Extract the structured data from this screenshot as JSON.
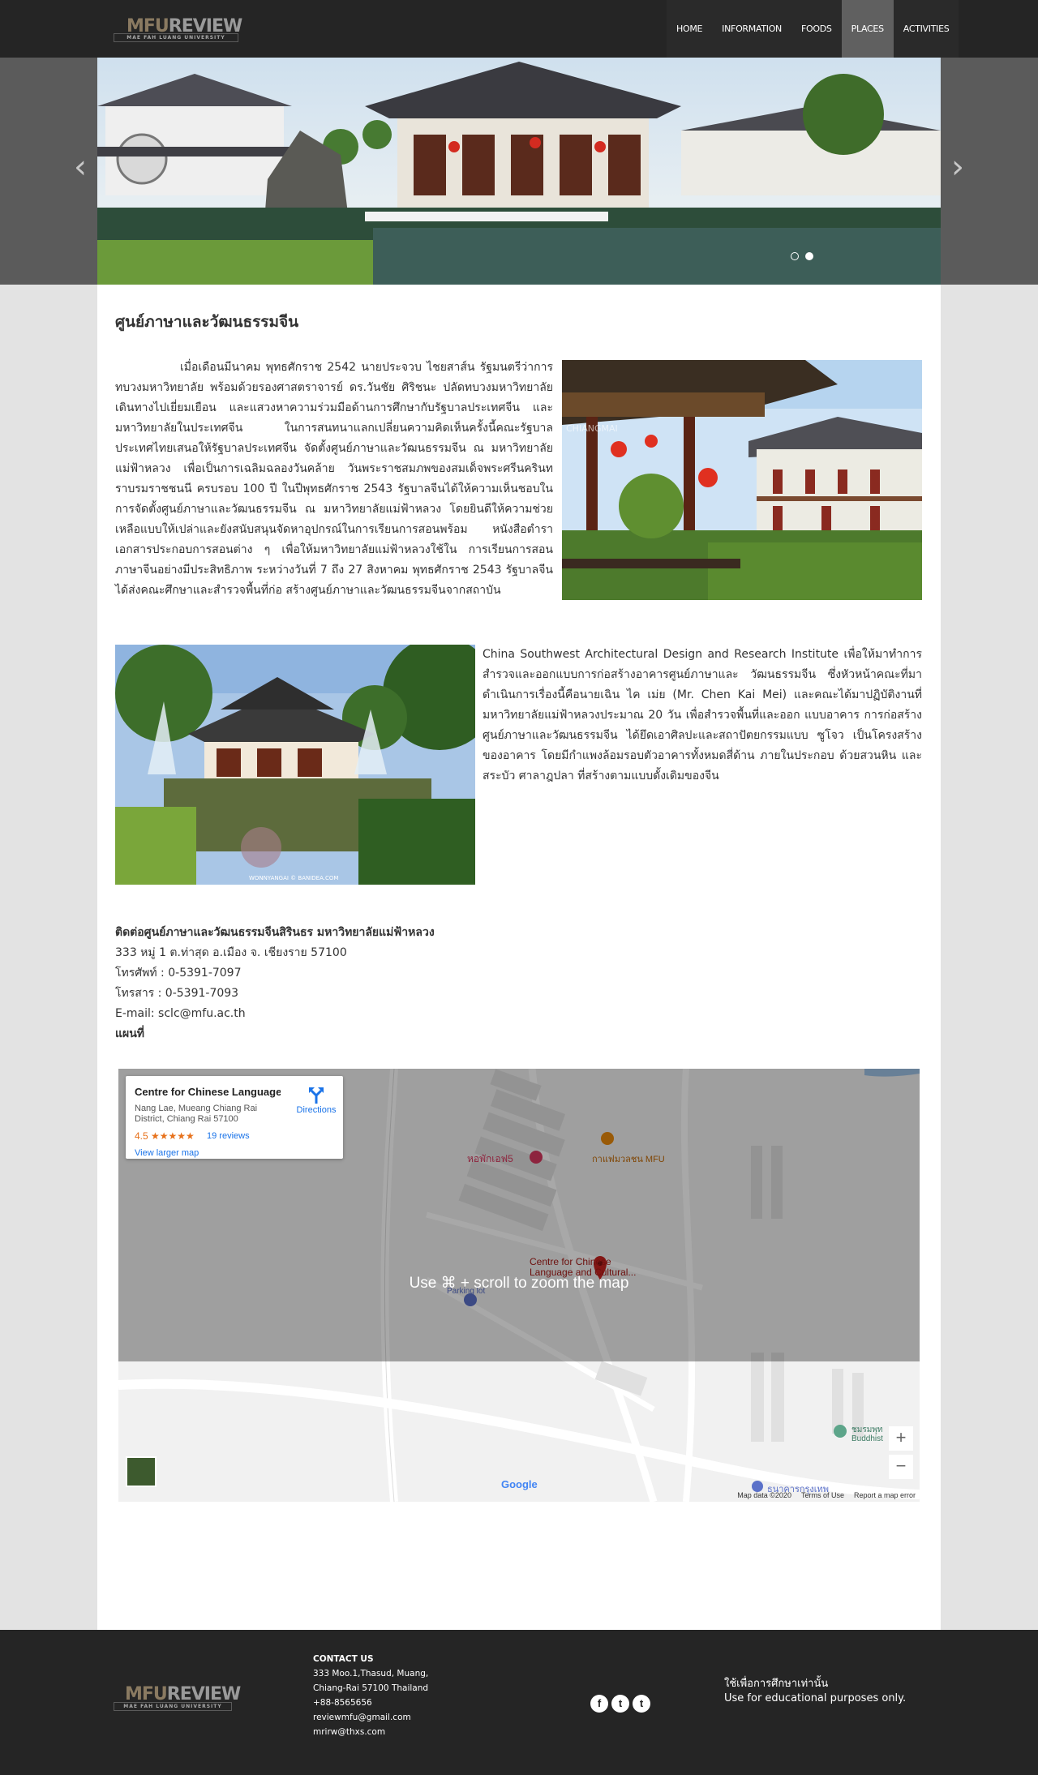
{
  "navbar": {
    "logo": {
      "main_a": "MFU",
      "main_b": "REVIEW",
      "sub": "MAE FAH LUANG UNIVERSITY"
    },
    "items": [
      {
        "label": "HOME"
      },
      {
        "label": "INFORMATION"
      },
      {
        "label": "FOODS"
      },
      {
        "label": "PLACES",
        "active": true
      },
      {
        "label": "ACTIVITIES"
      }
    ]
  },
  "carousel": {
    "prev_icon": "chevron-left-icon",
    "next_icon": "chevron-right-icon",
    "prev_glyph": "‹",
    "next_glyph": "›"
  },
  "content": {
    "title": "ศูนย์ภาษาและวัฒนธรรมจีน",
    "paragraph1": "เมื่อเดือนมีนาคม พุทธศักราช 2542 นายประจวบ ไชยสาส์น รัฐมนตรีว่าการทบวงมหาวิทยาลัย พร้อมด้วยรองศาสตราจารย์ ดร.วันชัย ศิริชนะ ปลัดทบวงมหาวิทยาลัยเดินทางไปเยี่ยมเยือน และแสวงหาความร่วมมือด้านการศึกษากับรัฐบาลประเทศจีน และมหาวิทยาลัยในประเทศจีน ในการสนทนาแลกเปลี่ยนความคิดเห็นครั้งนี้คณะรัฐบาลประเทศไทยเสนอให้รัฐบาลประเทศจีน จัดตั้งศูนย์ภาษาและวัฒนธรรมจีน ณ มหาวิทยาลัยแม่ฟ้าหลวง เพื่อเป็นการเฉลิมฉลองวันคล้าย วันพระราชสมภพของสมเด็จพระศรีนครินทราบรมราชชนนี ครบรอบ 100 ปี ในปีพุทธศักราช 2543 รัฐบาลจีนได้ให้ความเห็นชอบในการจัดตั้งศูนย์ภาษาและวัฒนธรรมจีน ณ มหาวิทยาลัยแม่ฟ้าหลวง โดยยินดีให้ความช่วยเหลือแบบให้เปล่าและยังสนับสนุนจัดหาอุปกรณ์ในการเรียนการสอนพร้อม หนังสือตำราเอกสารประกอบการสอนต่าง ๆ เพื่อให้มหาวิทยาลัยแม่ฟ้าหลวงใช้ใน การเรียนการสอน ภาษาจีนอย่างมีประสิทธิภาพ ระหว่างวันที่ 7 ถึง 27 สิงหาคม พุทธศักราช 2543 รัฐบาลจีนได้ส่งคณะศึกษาและสำรวจพื้นที่ก่อ สร้างศูนย์ภาษาและวัฒนธรรมจีนจากสถาบัน",
    "paragraph2": "China Southwest Architectural Design and Research Institute เพื่อให้มาทำการสำรวจและออกแบบการก่อสร้างอาคารศูนย์ภาษาและ วัฒนธรรมจีน ซึ่งหัวหน้าคณะที่มาดำเนินการเรื่องนี้คือนายเฉิน ไค เม่ย (Mr. Chen Kai Mei) และคณะได้มาปฏิบัติงานที่มหาวิทยาลัยแม่ฟ้าหลวงประมาณ 20 วัน เพื่อสำรวจพื้นที่และออก แบบอาคาร การก่อสร้างศูนย์ภาษาและวัฒนธรรมจีน ได้ยึดเอาศิลปะและสถาปัตยกรรมแบบ ซูโจว เป็นโครงสร้างของอาคาร โดยมีกำแพงล้อมรอบตัวอาคารทั้งหมดสี่ด้าน ภายในประกอบ ด้วยสวนหิน และสระบัว ศาลาฎปลา ที่สร้างตามแบบดั้งเดิมของจีน",
    "img2_caption": "WONNYANGAI © BANIDEA.COM",
    "contact": {
      "heading": "ติดต่อศูนย์ภาษาและวัฒนธรรมจีนสิรินธร มหาวิทยาลัยแม่ฟ้าหลวง",
      "address": "333 หมู่ 1 ต.ท่าสุด อ.เมือง จ. เชียงราย 57100",
      "phone": "โทรศัพท์ : 0-5391-7097",
      "fax": "โทรสาร : 0-5391-7093",
      "email": "E-mail: sclc@mfu.ac.th",
      "map_label": "แผนที่"
    }
  },
  "map": {
    "place_name": "Centre for Chinese Language ...",
    "address": "Nang Lae, Mueang Chiang Rai District, Chiang Rai 57100",
    "rating": "4.5 ★★★★★",
    "reviews": "19 reviews",
    "larger_map": "View larger map",
    "directions": "Directions",
    "zoom_message": "Use ⌘ + scroll to zoom the map",
    "pin_label": "Centre for Chinese Language and Cultural...",
    "poi1": "หอพักเอฟ5",
    "poi2": "กาแฟมวลชน MFU",
    "poi3": "Parking lot",
    "poi4": "ชมรมพุท Buddhist",
    "poi5": "ธนาคารกรุงเทพ",
    "zoom_in": "+",
    "zoom_out": "−",
    "google": "Google",
    "footer_data": "Map data ©2020",
    "terms": "Terms of Use",
    "report": "Report a map error"
  },
  "footer": {
    "contact_heading": "CONTACT US",
    "contact_lines": [
      "333 Moo.1,Thasud, Muang,",
      "Chiang-Rai 57100 Thailand",
      "+88-8565656",
      "reviewmfu@gmail.com",
      "mrirw@thxs.com"
    ],
    "social": [
      {
        "icon": "facebook-icon",
        "glyph": "f"
      },
      {
        "icon": "twitter-icon",
        "glyph": "t"
      },
      {
        "icon": "tumblr-icon",
        "glyph": "t"
      }
    ],
    "note_th": "ใช้เพื่อการศึกษาเท่านั้น",
    "note_en": "Use for educational purposes only."
  }
}
